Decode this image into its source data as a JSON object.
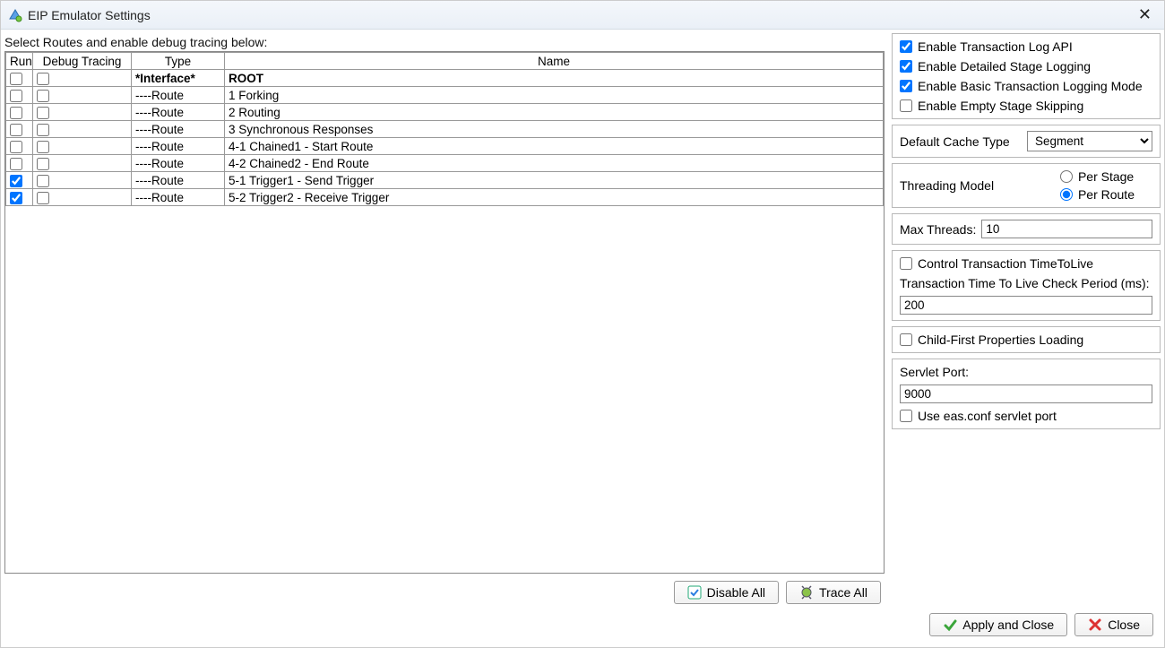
{
  "window": {
    "title": "EIP Emulator Settings"
  },
  "instruction": "Select Routes and enable debug tracing below:",
  "headers": {
    "run": "Run",
    "debug": "Debug Tracing",
    "type": "Type",
    "name": "Name"
  },
  "rows": [
    {
      "run": false,
      "dbg": false,
      "type": "*Interface*",
      "name": "ROOT",
      "root": true
    },
    {
      "run": false,
      "dbg": false,
      "type": "----Route",
      "name": "1 Forking"
    },
    {
      "run": false,
      "dbg": false,
      "type": "----Route",
      "name": "2 Routing"
    },
    {
      "run": false,
      "dbg": false,
      "type": "----Route",
      "name": "3 Synchronous Responses"
    },
    {
      "run": false,
      "dbg": false,
      "type": "----Route",
      "name": "4-1 Chained1 - Start Route"
    },
    {
      "run": false,
      "dbg": false,
      "type": "----Route",
      "name": "4-2 Chained2 - End Route"
    },
    {
      "run": true,
      "dbg": false,
      "type": "----Route",
      "name": "5-1 Trigger1 - Send Trigger"
    },
    {
      "run": true,
      "dbg": false,
      "type": "----Route",
      "name": "5-2 Trigger2 - Receive Trigger"
    }
  ],
  "leftButtons": {
    "disableAll": "Disable All",
    "traceAll": "Trace All"
  },
  "logging": {
    "txnLogApi": {
      "label": "Enable Transaction Log API",
      "checked": true
    },
    "detailStage": {
      "label": "Enable Detailed Stage Logging",
      "checked": true
    },
    "basicTxn": {
      "label": "Enable Basic Transaction Logging Mode",
      "checked": true
    },
    "emptyStage": {
      "label": "Enable Empty Stage Skipping",
      "checked": false
    }
  },
  "cache": {
    "label": "Default Cache Type",
    "value": "Segment"
  },
  "threading": {
    "label": "Threading Model",
    "perStage": "Per Stage",
    "perRoute": "Per Route",
    "selected": "perRoute"
  },
  "maxThreads": {
    "label": "Max Threads:",
    "value": "10"
  },
  "ttl": {
    "controlLabel": "Control Transaction TimeToLive",
    "controlChecked": false,
    "periodLabel": "Transaction Time To Live Check Period (ms):",
    "periodValue": "200"
  },
  "childFirst": {
    "label": "Child-First Properties Loading",
    "checked": false
  },
  "servlet": {
    "portLabel": "Servlet Port:",
    "portValue": "9000",
    "useEasLabel": "Use eas.conf servlet port",
    "useEasChecked": false
  },
  "bottomButtons": {
    "apply": "Apply and Close",
    "close": "Close"
  }
}
